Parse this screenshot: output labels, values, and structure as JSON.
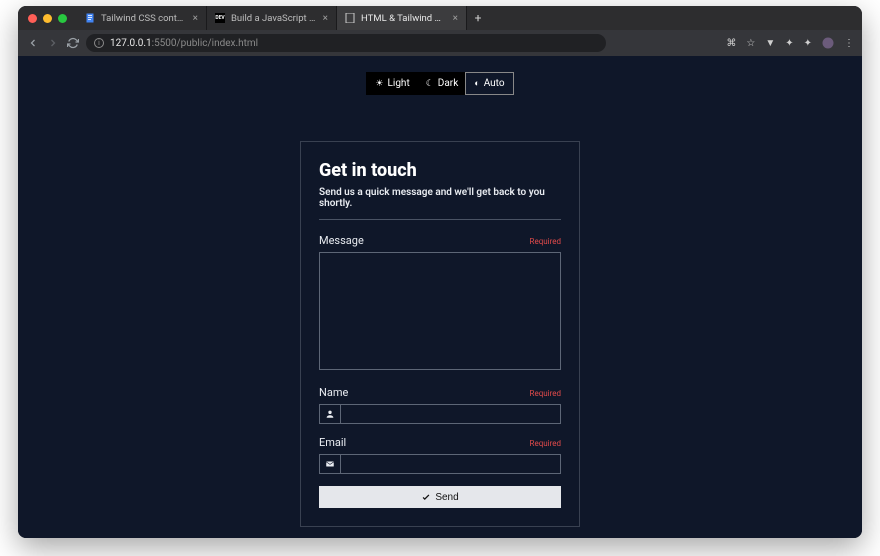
{
  "browser": {
    "tabs": [
      {
        "label": "Tailwind CSS contact form wit",
        "favicon_color": "#4285f4"
      },
      {
        "label": "Build a JavaScript and Tailwin"
      },
      {
        "label": "HTML & Tailwind CSS Contact"
      }
    ],
    "url_host": "127.0.0.1",
    "url_port": ":5500",
    "url_path": "/public/index.html"
  },
  "theme": {
    "light": "Light",
    "dark": "Dark",
    "auto": "Auto"
  },
  "form": {
    "title": "Get in touch",
    "subtitle": "Send us a quick message and we'll get back to you shortly.",
    "message_label": "Message",
    "name_label": "Name",
    "email_label": "Email",
    "required": "Required",
    "send": "Send"
  }
}
